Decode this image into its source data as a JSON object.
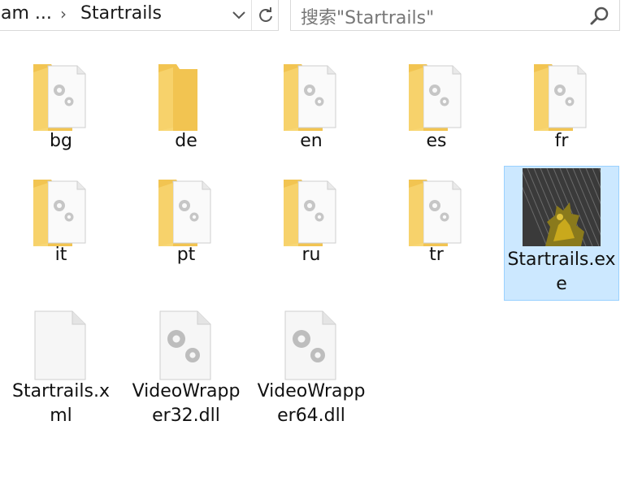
{
  "address": {
    "parent": "am ...",
    "separator": "›",
    "current": "Startrails"
  },
  "search": {
    "placeholder": "搜索\"Startrails\""
  },
  "items": [
    {
      "label": "bg",
      "kind": "folder-config"
    },
    {
      "label": "de",
      "kind": "folder-plain"
    },
    {
      "label": "en",
      "kind": "folder-config"
    },
    {
      "label": "es",
      "kind": "folder-config"
    },
    {
      "label": "fr",
      "kind": "folder-config"
    },
    {
      "label": "it",
      "kind": "folder-config"
    },
    {
      "label": "pt",
      "kind": "folder-config"
    },
    {
      "label": "ru",
      "kind": "folder-config"
    },
    {
      "label": "tr",
      "kind": "folder-config"
    },
    {
      "label": "Startrails.exe",
      "kind": "exe-thumbnail",
      "selected": true
    },
    {
      "label": "Startrails.xml",
      "kind": "blank-file"
    },
    {
      "label": "VideoWrapper32.dll",
      "kind": "dll-file"
    },
    {
      "label": "VideoWrapper64.dll",
      "kind": "dll-file"
    }
  ],
  "colors": {
    "selection_fill": "#cce8ff",
    "selection_border": "#99d1ff",
    "folder_yellow": "#f7d26b"
  }
}
